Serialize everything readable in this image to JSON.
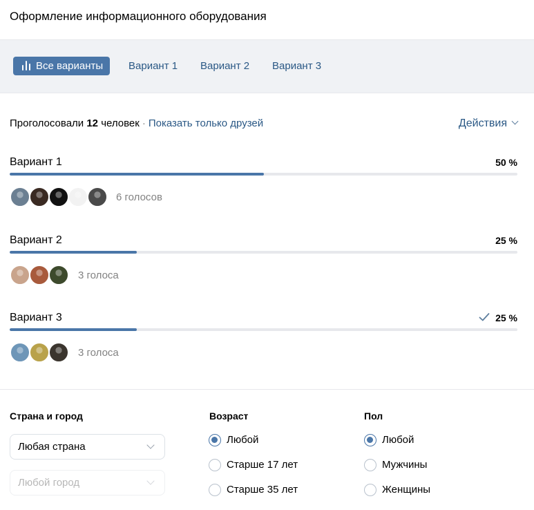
{
  "header": {
    "title": "Оформление информационного оборудования"
  },
  "tabs": [
    {
      "label": "Все варианты",
      "active": true
    },
    {
      "label": "Вариант 1",
      "active": false
    },
    {
      "label": "Вариант 2",
      "active": false
    },
    {
      "label": "Вариант 3",
      "active": false
    }
  ],
  "summary": {
    "prefix": "Проголосовали",
    "count": "12",
    "suffix": "человек",
    "separator": "·",
    "friends_link": "Показать только друзей",
    "actions_label": "Действия"
  },
  "options": [
    {
      "label": "Вариант 1",
      "percent_label": "50 %",
      "share": 0.5,
      "votes_label": "6 голосов",
      "avatars": [
        "#6b7f92",
        "#3a2a22",
        "#111111",
        "#f2f2f2",
        "#4a4a4a"
      ],
      "voted_by_me": false
    },
    {
      "label": "Вариант 2",
      "percent_label": "25 %",
      "share": 0.25,
      "votes_label": "3 голоса",
      "avatars": [
        "#c9a48c",
        "#a85a3c",
        "#3d4a2c"
      ],
      "voted_by_me": false
    },
    {
      "label": "Вариант 3",
      "percent_label": "25 %",
      "share": 0.25,
      "votes_label": "3 голоса",
      "avatars": [
        "#6e96b8",
        "#b9a24a",
        "#3b352e"
      ],
      "voted_by_me": true
    }
  ],
  "filters": {
    "location": {
      "title": "Страна и город",
      "country": "Любая страна",
      "city_placeholder": "Любой город"
    },
    "age": {
      "title": "Возраст",
      "options": [
        "Любой",
        "Старше 17 лет",
        "Старше 35 лет"
      ],
      "selected": 0
    },
    "gender": {
      "title": "Пол",
      "options": [
        "Любой",
        "Мужчины",
        "Женщины"
      ],
      "selected": 0
    }
  },
  "colors": {
    "accent": "#4a76a8",
    "link": "#2a5885",
    "muted": "#828282",
    "bar_track": "#e7e8ec"
  }
}
